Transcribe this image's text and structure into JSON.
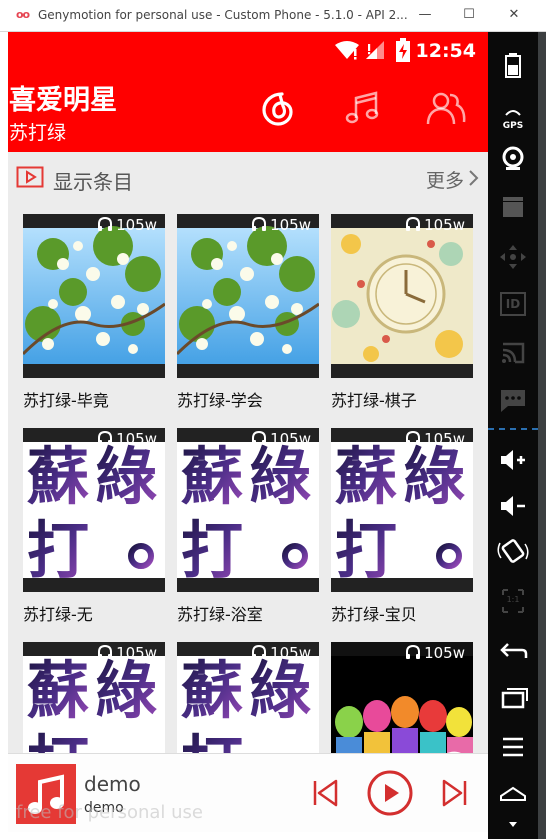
{
  "window": {
    "title": "Genymotion for personal use - Custom Phone - 5.1.0 - API 2...",
    "logo_text": "oo",
    "min_label": "—",
    "max_label": "☐",
    "close_label": "✕"
  },
  "statusbar": {
    "time": "12:54"
  },
  "header": {
    "title": "喜爱明星",
    "subtitle": "苏打绿",
    "tabs": [
      {
        "icon": "netease-music-icon"
      },
      {
        "icon": "music-note-icon"
      },
      {
        "icon": "friends-icon"
      }
    ]
  },
  "section": {
    "title": "显示条目",
    "more": "更多"
  },
  "cards": [
    {
      "title": "苏打绿-毕竟",
      "plays": "105w",
      "art": "flowers"
    },
    {
      "title": "苏打绿-学会",
      "plays": "105w",
      "art": "flowers"
    },
    {
      "title": "苏打绿-棋子",
      "plays": "105w",
      "art": "clock"
    },
    {
      "title": "苏打绿-无",
      "plays": "105w",
      "art": "calligraphy"
    },
    {
      "title": "苏打绿-浴室",
      "plays": "105w",
      "art": "calligraphy"
    },
    {
      "title": "苏打绿-宝贝",
      "plays": "105w",
      "art": "calligraphy"
    },
    {
      "title": "",
      "plays": "105w",
      "art": "calligraphy"
    },
    {
      "title": "",
      "plays": "105w",
      "art": "calligraphy"
    },
    {
      "title": "",
      "plays": "105w",
      "art": "band"
    }
  ],
  "player": {
    "song": "demo",
    "artist": "demo"
  },
  "watermark": "free for personal use",
  "sidebar": {
    "gps_label": "GPS",
    "id_label": "ID",
    "scale_label": "1:1"
  },
  "colors": {
    "accent": "#ff0000",
    "player_accent": "#d32f2f"
  }
}
